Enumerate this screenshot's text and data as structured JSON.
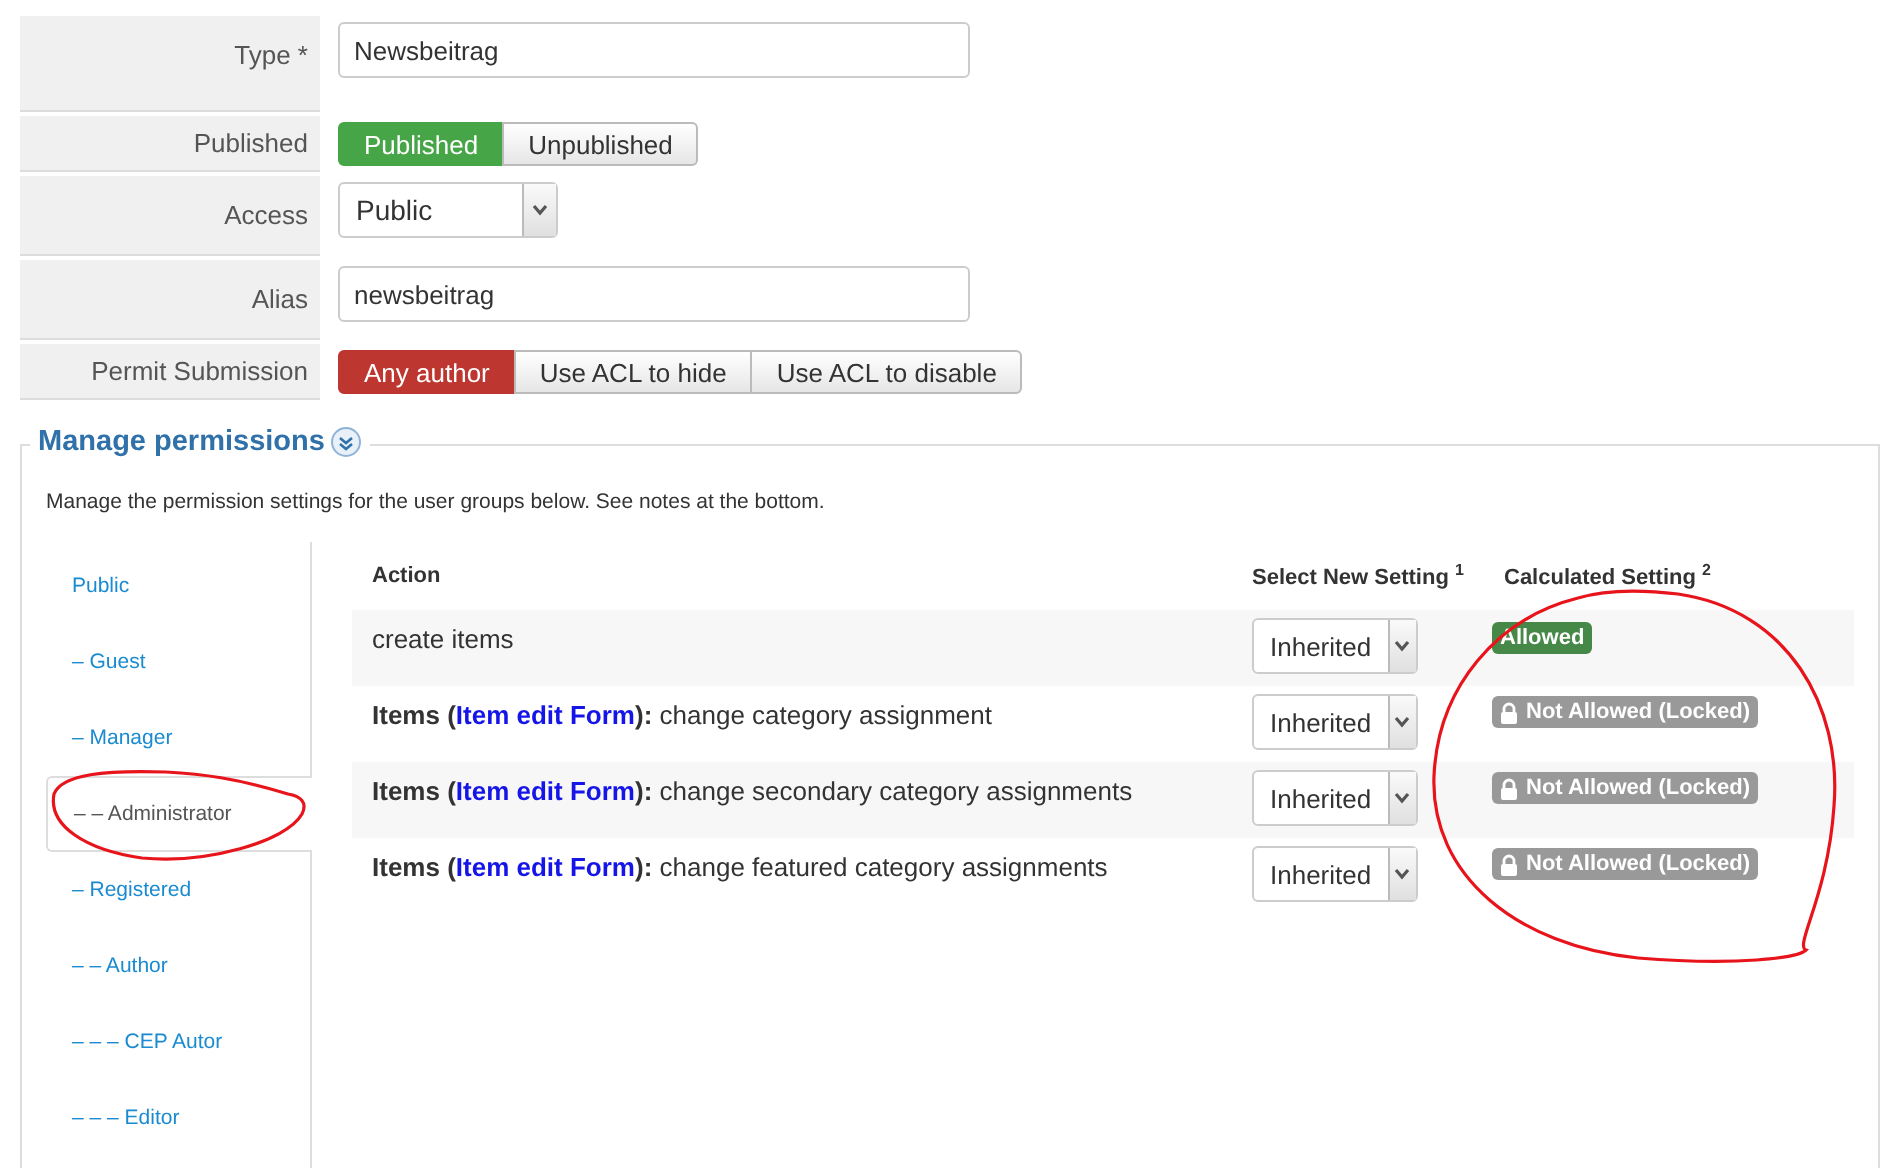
{
  "form": [
    {
      "label": "Type *",
      "kind": "text",
      "value": "Newsbeitrag"
    },
    {
      "label": "Published",
      "kind": "toggle",
      "color": "#46a546",
      "options": [
        {
          "label": "Published",
          "selected": true
        },
        {
          "label": "Unpublished",
          "selected": false
        }
      ]
    },
    {
      "label": "Access",
      "kind": "select",
      "value": "Public"
    },
    {
      "label": "Alias",
      "kind": "text",
      "value": "newsbeitrag"
    },
    {
      "label": "Permit Submission",
      "kind": "toggle",
      "color": "#bd362f",
      "options": [
        {
          "label": "Any author",
          "selected": true
        },
        {
          "label": "Use ACL to hide",
          "selected": false
        },
        {
          "label": "Use ACL to disable",
          "selected": false
        }
      ]
    }
  ],
  "permissions": {
    "title": "Manage permissions",
    "description": "Manage the permission settings for the user groups below. See notes at the bottom.",
    "groups": [
      {
        "label": "Public",
        "selected": false,
        "marked": false
      },
      {
        "label": "– Guest",
        "selected": false,
        "marked": false
      },
      {
        "label": "– Manager",
        "selected": false,
        "marked": false
      },
      {
        "label": "– – Administrator",
        "selected": true,
        "marked": true
      },
      {
        "label": "– Registered",
        "selected": false,
        "marked": false
      },
      {
        "label": "– – Author",
        "selected": false,
        "marked": false
      },
      {
        "label": "– – – CEP Autor",
        "selected": false,
        "marked": false
      },
      {
        "label": "– – – Editor",
        "selected": false,
        "marked": false
      }
    ],
    "columns": [
      "Action",
      "Select New Setting $^{1}$",
      "Calculated Setting $^{2}$"
    ],
    "calculated_marked": true,
    "rows": [
      {
        "action": [
          {
            "text": "create items",
            "kind": "plain"
          }
        ],
        "setting": "Inherited",
        "calculated": {
          "kind": "allowed",
          "text": "Allowed"
        }
      },
      {
        "action": [
          {
            "text": "Items (",
            "kind": "bold"
          },
          {
            "text": "Item edit Form",
            "kind": "link"
          },
          {
            "text": "):",
            "kind": "bold"
          },
          {
            "text": " change category assignment",
            "kind": "plain"
          }
        ],
        "setting": "Inherited",
        "calculated": {
          "kind": "locked",
          "text": "Not Allowed (Locked)"
        }
      },
      {
        "action": [
          {
            "text": "Items (",
            "kind": "bold"
          },
          {
            "text": "Item edit Form",
            "kind": "link"
          },
          {
            "text": "):",
            "kind": "bold"
          },
          {
            "text": " change secondary category assignments",
            "kind": "plain"
          }
        ],
        "setting": "Inherited",
        "calculated": {
          "kind": "locked",
          "text": "Not Allowed (Locked)"
        }
      },
      {
        "action": [
          {
            "text": "Items (",
            "kind": "bold"
          },
          {
            "text": "Item edit Form",
            "kind": "link"
          },
          {
            "text": "):",
            "kind": "bold"
          },
          {
            "text": " change featured category assignments",
            "kind": "plain"
          }
        ],
        "setting": "Inherited",
        "calculated": {
          "kind": "locked",
          "text": "Not Allowed (Locked)"
        }
      }
    ]
  }
}
